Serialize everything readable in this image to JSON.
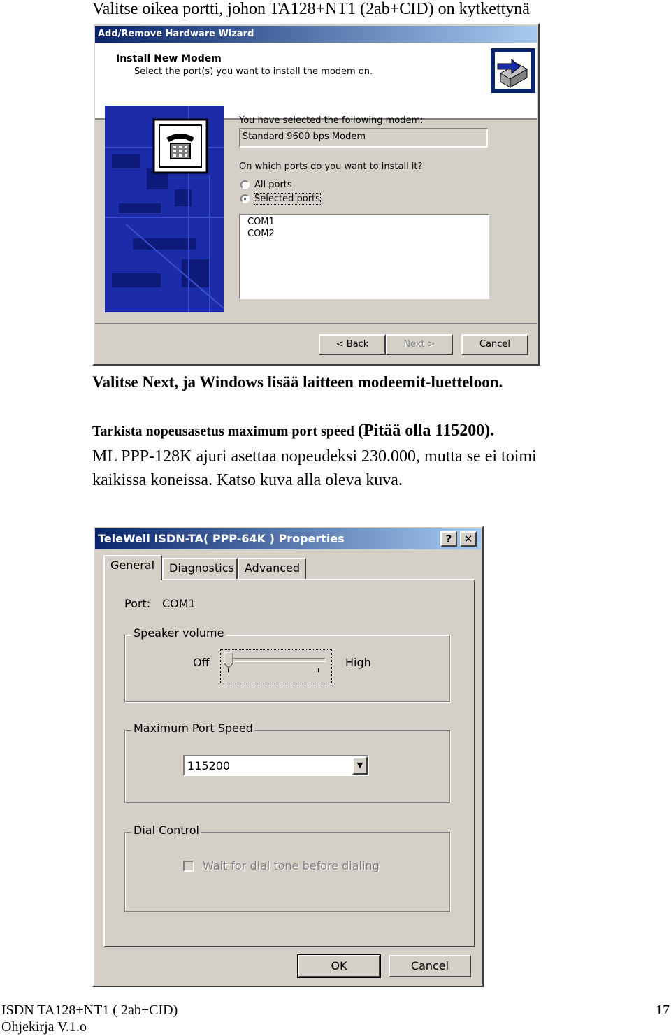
{
  "doc": {
    "line1": "Valitse oikea portti, johon TA128+NT1 (2ab+CID) on kytkettynä",
    "line2": "Valitse Next, ja Windows lisää laitteen modeemit-luetteloon.",
    "line3a": "Tarkista nopeusasetus maximum port speed ",
    "line3b": "(Pitää olla 115200).",
    "line4": "ML PPP-128K ajuri asettaa nopeudeksi 230.000, mutta se ei toimi",
    "line5": "kaikissa koneissa. Katso kuva alla oleva kuva."
  },
  "wizard": {
    "title": "Add/Remove Hardware Wizard",
    "header_title": "Install New Modem",
    "header_subtitle": "Select the port(s) you want to install the modem on.",
    "selected_modem_label": "You have selected the following modem:",
    "selected_modem": "Standard  9600 bps Modem",
    "ports_question": "On which ports do you want to install it?",
    "radio_all": "All ports",
    "radio_selected": "Selected ports",
    "ports": [
      "COM1",
      "COM2"
    ],
    "back": "< Back",
    "next": "Next >",
    "cancel": "Cancel"
  },
  "props": {
    "title": "TeleWell ISDN-TA( PPP-64K ) Properties",
    "help_btn": "?",
    "close_btn": "✕",
    "tabs": [
      "General",
      "Diagnostics",
      "Advanced"
    ],
    "port_label": "Port:",
    "port_value": "COM1",
    "speaker_group": "Speaker volume",
    "off": "Off",
    "high": "High",
    "speaker_level": 0,
    "max_speed_group": "Maximum Port Speed",
    "max_speed_value": "115200",
    "dial_group": "Dial Control",
    "dial_checkbox": "Wait for dial tone before dialing",
    "ok": "OK",
    "cancel": "Cancel"
  },
  "footer": {
    "line1": "ISDN TA128+NT1 ( 2ab+CID)",
    "line2": "Ohjekirja V.1.o",
    "page": "17"
  }
}
